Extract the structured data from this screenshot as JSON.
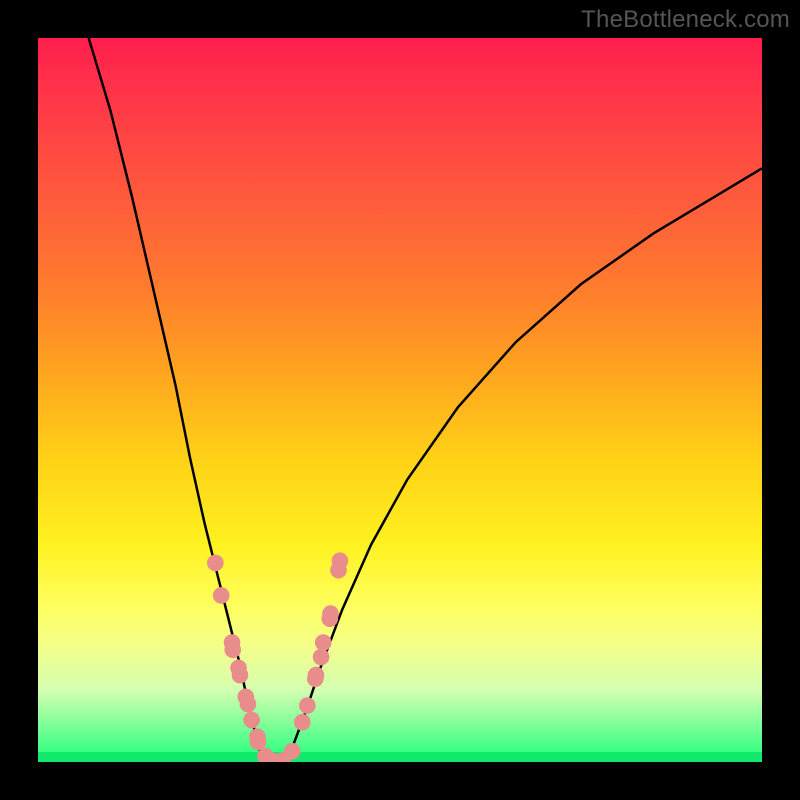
{
  "watermark": "TheBottleneck.com",
  "chart_data": {
    "type": "line",
    "title": "",
    "xlabel": "",
    "ylabel": "",
    "xlim": [
      0,
      100
    ],
    "ylim": [
      0,
      100
    ],
    "curve_left": {
      "x": [
        7,
        10,
        13,
        16,
        19,
        21,
        23,
        25,
        26.5,
        28,
        29,
        30,
        30.5,
        31,
        31.5
      ],
      "y": [
        100,
        90,
        78,
        65,
        52,
        42,
        33,
        25,
        19,
        13,
        8,
        4,
        2,
        0.5,
        0
      ]
    },
    "curve_right": {
      "x": [
        34,
        34.5,
        35.5,
        37,
        39,
        42,
        46,
        51,
        58,
        66,
        75,
        85,
        95,
        100
      ],
      "y": [
        0,
        0.5,
        3,
        7,
        13,
        21,
        30,
        39,
        49,
        58,
        66,
        73,
        79,
        82
      ]
    },
    "dots_left": {
      "x": [
        24.5,
        25.3,
        26.8,
        26.9,
        27.7,
        27.9,
        28.7,
        29.0,
        29.5,
        30.3,
        30.4,
        31.4,
        32.3
      ],
      "y": [
        27.5,
        23.0,
        16.5,
        15.5,
        13.0,
        12.0,
        9.0,
        8.0,
        5.8,
        3.5,
        2.8,
        0.8,
        0.2
      ]
    },
    "dots_right": {
      "x": [
        33.8,
        35.1,
        36.5,
        37.2,
        38.3,
        38.4,
        39.1,
        39.4,
        40.3,
        40.4,
        41.5,
        41.7
      ],
      "y": [
        0.2,
        1.5,
        5.5,
        7.8,
        11.5,
        12.0,
        14.5,
        16.5,
        19.8,
        20.5,
        26.5,
        27.8
      ]
    },
    "dot_color": "#e98c8c",
    "curve_color": "#000000"
  }
}
